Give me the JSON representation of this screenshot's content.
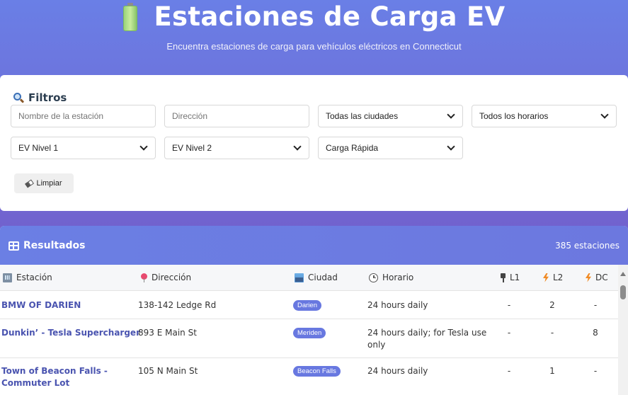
{
  "header": {
    "icon": "battery-icon",
    "title": "Estaciones de Carga EV",
    "subtitle": "Encuentra estaciones de carga para vehículos eléctricos en Connecticut"
  },
  "filters": {
    "title": "Filtros",
    "station_name_placeholder": "Nombre de la estación",
    "address_placeholder": "Dirección",
    "city_select": "Todas las ciudades",
    "hours_select": "Todos los horarios",
    "ev_level1_select": "EV Nivel 1",
    "ev_level2_select": "EV Nivel 2",
    "fast_charge_select": "Carga Rápida",
    "clear_label": "Limpiar"
  },
  "results": {
    "title": "Resultados",
    "count": "385 estaciones",
    "columns": {
      "station": "Estación",
      "address": "Dirección",
      "city": "Ciudad",
      "hours": "Horario",
      "l1": "L1",
      "l2": "L2",
      "dc": "DC"
    },
    "rows": [
      {
        "name": "BMW OF DARIEN",
        "address": "138-142 Ledge Rd",
        "city": "Darien",
        "hours": "24 hours daily",
        "l1": "-",
        "l2": "2",
        "dc": "-"
      },
      {
        "name": "Dunkin’ - Tesla Supercharger",
        "address": "893 E Main St",
        "city": "Meriden",
        "hours": "24 hours daily; for Tesla use only",
        "l1": "-",
        "l2": "-",
        "dc": "8"
      },
      {
        "name": "Town of Beacon Falls - Commuter Lot",
        "address": "105 N Main St",
        "city": "Beacon Falls",
        "hours": "24 hours daily",
        "l1": "-",
        "l2": "1",
        "dc": "-"
      }
    ]
  },
  "colors": {
    "header_gradient_start": "#6a7fe6",
    "header_gradient_end": "#7a58bf",
    "results_header": "#6b7fe4",
    "badge": "#6878e0",
    "station_link": "#4a54b0"
  }
}
